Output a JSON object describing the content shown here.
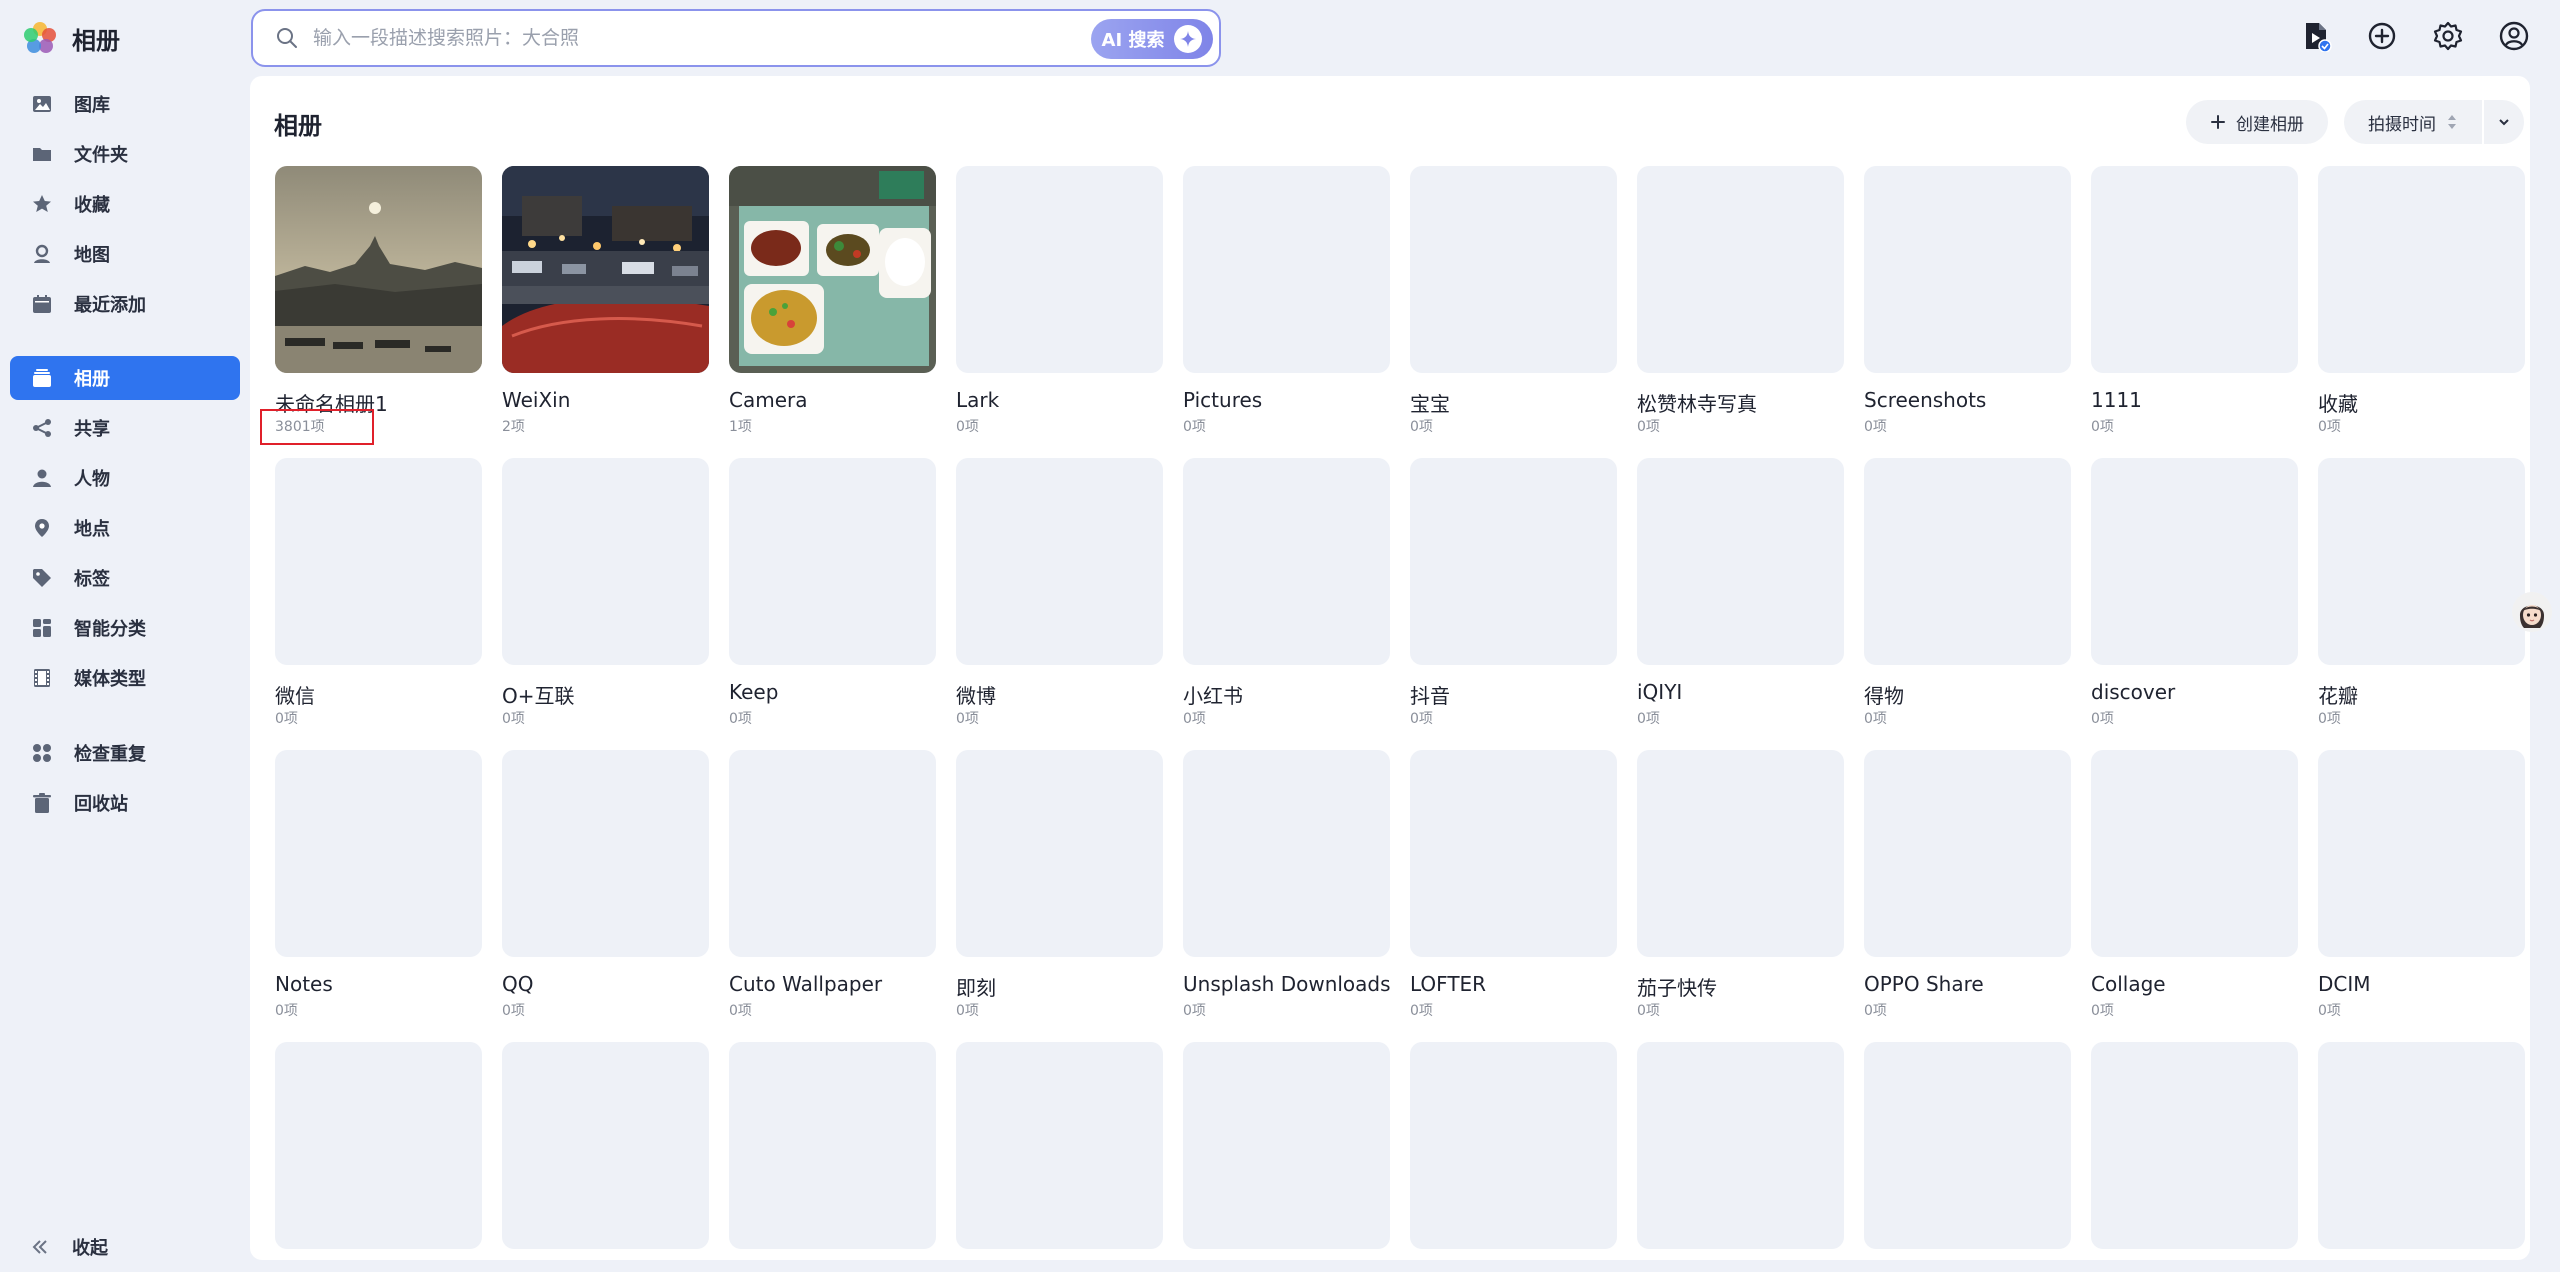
{
  "app": {
    "title": "相册"
  },
  "search": {
    "placeholder": "输入一段描述搜索照片：大合照",
    "ai_label": "AI 搜索"
  },
  "sidebar": {
    "items": [
      {
        "label": "图库",
        "icon": "image-icon"
      },
      {
        "label": "文件夹",
        "icon": "folder-icon"
      },
      {
        "label": "收藏",
        "icon": "star-icon"
      },
      {
        "label": "地图",
        "icon": "map-pin-icon"
      },
      {
        "label": "最近添加",
        "icon": "calendar-icon"
      },
      {
        "label": "相册",
        "icon": "album-icon",
        "active": true
      },
      {
        "label": "共享",
        "icon": "share-icon"
      },
      {
        "label": "人物",
        "icon": "person-icon"
      },
      {
        "label": "地点",
        "icon": "location-icon"
      },
      {
        "label": "标签",
        "icon": "tag-icon"
      },
      {
        "label": "智能分类",
        "icon": "grid-icon"
      },
      {
        "label": "媒体类型",
        "icon": "film-icon"
      },
      {
        "label": "检查重复",
        "icon": "duplicate-icon"
      },
      {
        "label": "回收站",
        "icon": "trash-icon"
      }
    ],
    "collapse_label": "收起"
  },
  "main": {
    "title": "相册",
    "create_label": "创建相册",
    "sort_label": "拍摄时间"
  },
  "albums": [
    {
      "name": "未命名相册1",
      "count": "3801项",
      "thumb": "lake-sunset"
    },
    {
      "name": "WeiXin",
      "count": "2项",
      "thumb": "night-street"
    },
    {
      "name": "Camera",
      "count": "1项",
      "thumb": "food-plates"
    },
    {
      "name": "Lark",
      "count": "0项"
    },
    {
      "name": "Pictures",
      "count": "0项"
    },
    {
      "name": "宝宝",
      "count": "0项"
    },
    {
      "name": "松赞林寺写真",
      "count": "0项"
    },
    {
      "name": "Screenshots",
      "count": "0项"
    },
    {
      "name": "1111",
      "count": "0项"
    },
    {
      "name": "收藏",
      "count": "0项"
    },
    {
      "name": "微信",
      "count": "0项"
    },
    {
      "name": "O+互联",
      "count": "0项"
    },
    {
      "name": "Keep",
      "count": "0项"
    },
    {
      "name": "微博",
      "count": "0项"
    },
    {
      "name": "小红书",
      "count": "0项"
    },
    {
      "name": "抖音",
      "count": "0项"
    },
    {
      "name": "iQIYI",
      "count": "0项"
    },
    {
      "name": "得物",
      "count": "0项"
    },
    {
      "name": "discover",
      "count": "0项"
    },
    {
      "name": "花瓣",
      "count": "0项"
    },
    {
      "name": "Notes",
      "count": "0项"
    },
    {
      "name": "QQ",
      "count": "0项"
    },
    {
      "name": "Cuto Wallpaper",
      "count": "0项"
    },
    {
      "name": "即刻",
      "count": "0项"
    },
    {
      "name": "Unsplash Downloads",
      "count": "0项"
    },
    {
      "name": "LOFTER",
      "count": "0项"
    },
    {
      "name": "茄子快传",
      "count": "0项"
    },
    {
      "name": "OPPO Share",
      "count": "0项"
    },
    {
      "name": "Collage",
      "count": "0项"
    },
    {
      "name": "DCIM",
      "count": "0项"
    },
    {
      "name": "",
      "count": ""
    },
    {
      "name": "",
      "count": ""
    },
    {
      "name": "",
      "count": ""
    },
    {
      "name": "",
      "count": ""
    },
    {
      "name": "",
      "count": ""
    },
    {
      "name": "",
      "count": ""
    },
    {
      "name": "",
      "count": ""
    },
    {
      "name": "",
      "count": ""
    },
    {
      "name": "",
      "count": ""
    },
    {
      "name": "",
      "count": ""
    }
  ],
  "colors": {
    "accent": "#2f74ef",
    "search_border": "#8b93ec",
    "highlight": "#e0202a"
  }
}
